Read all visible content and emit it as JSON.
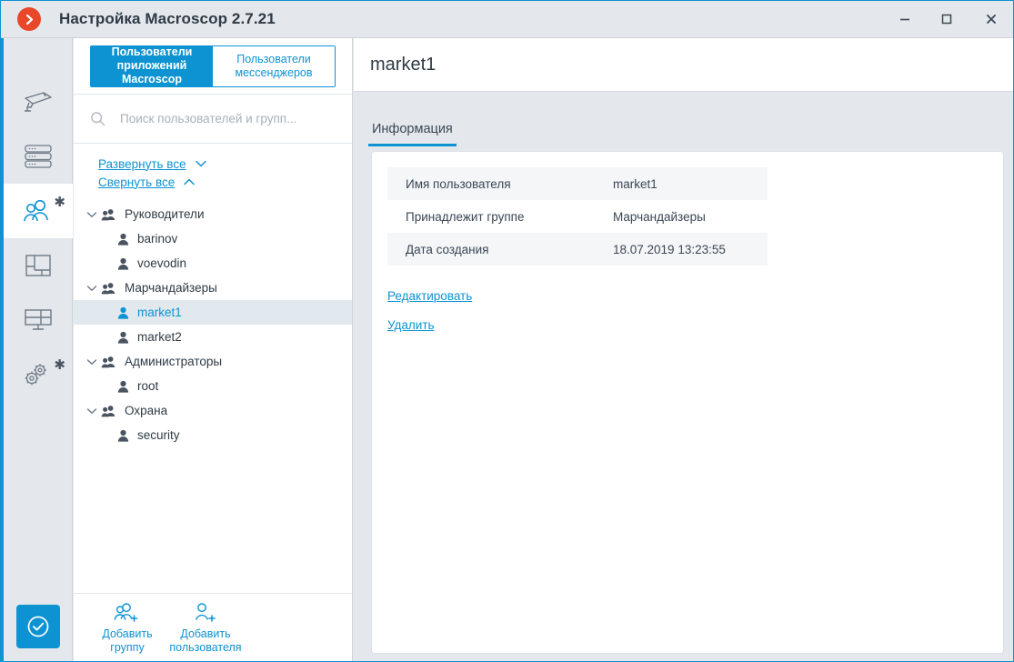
{
  "window": {
    "title": "Настройка Macroscop 2.7.21",
    "logo_icon": "chevron-right-circle-icon",
    "controls": {
      "minimize": "minimize-icon",
      "maximize": "maximize-icon",
      "close": "close-icon"
    },
    "accent_color": "#0d93d2",
    "logo_color": "#e8472a",
    "chrome_color": "#e4e8ec"
  },
  "rail": {
    "items": [
      {
        "name": "cameras",
        "icon": "camera-icon",
        "active": false,
        "starred": false
      },
      {
        "name": "servers",
        "icon": "server-icon",
        "active": false,
        "starred": false
      },
      {
        "name": "users",
        "icon": "users-icon",
        "active": true,
        "starred": true
      },
      {
        "name": "plans",
        "icon": "floor-plan-icon",
        "active": false,
        "starred": false
      },
      {
        "name": "video-walls",
        "icon": "video-wall-icon",
        "active": false,
        "starred": false
      },
      {
        "name": "options",
        "icon": "gears-icon",
        "active": false,
        "starred": true
      }
    ],
    "apply": {
      "icon": "check-circle-icon"
    }
  },
  "left_panel": {
    "segmented": {
      "tabs": [
        {
          "line1": "Пользователи",
          "line2": "приложений Macroscop",
          "active": true
        },
        {
          "line1": "Пользователи",
          "line2": "мессенджеров",
          "active": false
        }
      ]
    },
    "search": {
      "icon": "search-icon",
      "placeholder": "Поиск пользователей и групп...",
      "value": ""
    },
    "tools": [
      {
        "label": "Развернуть все",
        "icon": "chevron-down-icon"
      },
      {
        "label": "Свернуть все",
        "icon": "chevron-up-icon"
      }
    ],
    "tree": [
      {
        "type": "group",
        "label": "Руководители",
        "icon": "group-icon",
        "caret": "chevron-down-icon",
        "selected": false
      },
      {
        "type": "user",
        "label": "barinov",
        "icon": "user-icon",
        "selected": false
      },
      {
        "type": "user",
        "label": "voevodin",
        "icon": "user-icon",
        "selected": false
      },
      {
        "type": "group",
        "label": "Марчандайзеры",
        "icon": "group-icon",
        "caret": "chevron-down-icon",
        "selected": false
      },
      {
        "type": "user",
        "label": "market1",
        "icon": "user-icon",
        "selected": true
      },
      {
        "type": "user",
        "label": "market2",
        "icon": "user-icon",
        "selected": false
      },
      {
        "type": "group",
        "label": "Администраторы",
        "icon": "group-icon",
        "caret": "chevron-down-icon",
        "selected": false
      },
      {
        "type": "user",
        "label": "root",
        "icon": "user-icon",
        "selected": false
      },
      {
        "type": "group",
        "label": "Охрана",
        "icon": "group-icon",
        "caret": "chevron-down-icon",
        "selected": false
      },
      {
        "type": "user",
        "label": "security",
        "icon": "user-icon",
        "selected": false
      }
    ],
    "footer_buttons": [
      {
        "line1": "Добавить",
        "line2": "группу",
        "icon": "add-group-icon"
      },
      {
        "line1": "Добавить",
        "line2": "пользователя",
        "icon": "add-user-icon"
      }
    ]
  },
  "content": {
    "page_title": "market1",
    "tabs": [
      {
        "label": "Информация",
        "active": true
      }
    ],
    "info_rows": [
      {
        "label": "Имя пользователя",
        "value": "market1"
      },
      {
        "label": "Принадлежит группе",
        "value": "Марчандайзеры"
      },
      {
        "label": "Дата создания",
        "value": "18.07.2019 13:23:55"
      }
    ],
    "links": [
      {
        "label": "Редактировать"
      },
      {
        "label": "Удалить"
      }
    ]
  }
}
